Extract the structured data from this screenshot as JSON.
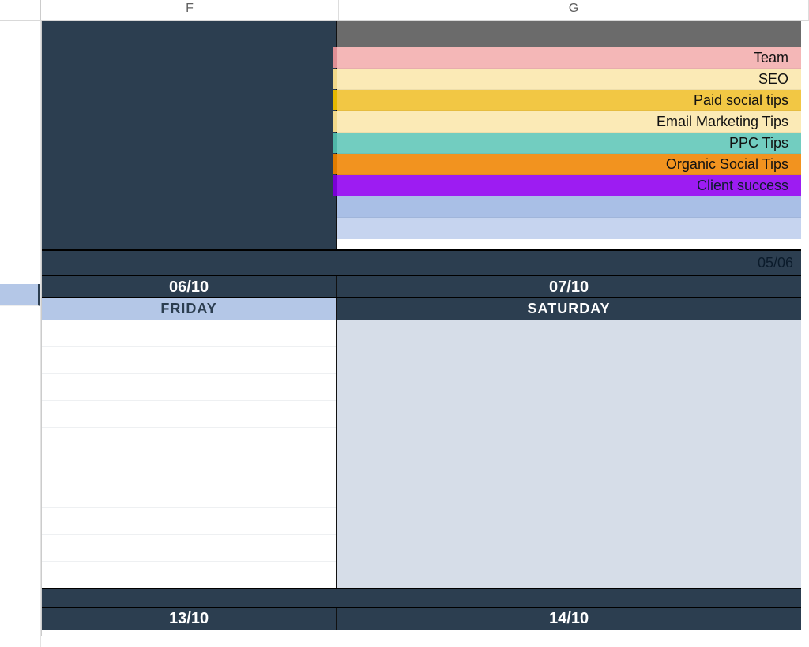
{
  "columns": {
    "f": "F",
    "g": "G"
  },
  "legend": [
    {
      "label": "",
      "bg": "#6b6b6b",
      "text": "#111",
      "accent": ""
    },
    {
      "label": "",
      "bg": "#6b6b6b",
      "text": "#111",
      "accent": ""
    },
    {
      "label": "Team",
      "bg": "#f4b7b7",
      "text": "#111",
      "accent": "#e08f95"
    },
    {
      "label": "SEO",
      "bg": "#fbeab6",
      "text": "#111",
      "accent": "#f2d98a"
    },
    {
      "label": "Paid social tips",
      "bg": "#f2c744",
      "text": "#111",
      "accent": "#e6b800"
    },
    {
      "label": "Email Marketing Tips",
      "bg": "#fbeab6",
      "text": "#111",
      "accent": "#f2d98a"
    },
    {
      "label": "PPC Tips",
      "bg": "#72cdc0",
      "text": "#111",
      "accent": "#4fb7a8"
    },
    {
      "label": "Organic Social Tips",
      "bg": "#f2931f",
      "text": "#111",
      "accent": "#e07c00"
    },
    {
      "label": "Client success",
      "bg": "#9d1cf2",
      "text": "#0b1b2b",
      "accent": "#7a00d6"
    },
    {
      "label": "",
      "bg": "#a9bfe6",
      "text": "#111",
      "accent": ""
    },
    {
      "label": "",
      "bg": "#c6d4ef",
      "text": "#111",
      "accent": ""
    }
  ],
  "sep_right_text": "05/06",
  "week1": {
    "f_date": "06/10",
    "g_date": "07/10",
    "f_day": "FRIDAY",
    "g_day": "SATURDAY"
  },
  "week2": {
    "f_date": "13/10",
    "g_date": "14/10"
  }
}
